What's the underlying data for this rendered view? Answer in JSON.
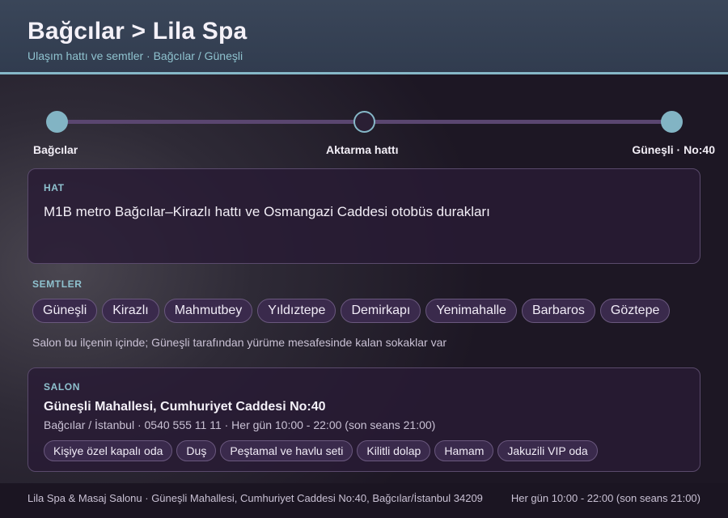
{
  "header": {
    "title": "Bağcılar > Lila Spa",
    "subtitle": "Ulaşım hattı ve semtler · Bağcılar / Güneşli"
  },
  "route": {
    "stops": [
      {
        "label": "Bağcılar",
        "style": "filled"
      },
      {
        "label": "Aktarma hattı",
        "style": "hollow"
      },
      {
        "label": "Güneşli · No:40",
        "style": "filled"
      }
    ]
  },
  "hat": {
    "caption": "HAT",
    "description": "M1B metro Bağcılar–Kirazlı hattı ve Osmangazi Caddesi otobüs durakları"
  },
  "semtler": {
    "caption": "SEMTLER",
    "items": [
      "Güneşli",
      "Kirazlı",
      "Mahmutbey",
      "Yıldıztepe",
      "Demirkapı",
      "Yenimahalle",
      "Barbaros",
      "Göztepe"
    ],
    "note": "Salon bu ilçenin içinde; Güneşli tarafından yürüme mesafesinde kalan sokaklar var"
  },
  "salon": {
    "caption": "SALON",
    "address": "Güneşli Mahallesi, Cumhuriyet Caddesi No:40",
    "meta": "Bağcılar / İstanbul · 0540 555 11 11 · Her gün 10:00 - 22:00 (son seans 21:00)",
    "amenities": [
      "Kişiye özel kapalı oda",
      "Duş",
      "Peştamal ve havlu seti",
      "Kilitli dolap",
      "Hamam",
      "Jakuzili VIP oda"
    ]
  },
  "footer": {
    "left": "Lila Spa & Masaj Salonu · Güneşli Mahallesi, Cumhuriyet Caddesi No:40, Bağcılar/İstanbul 34209",
    "right": "Her gün 10:00 - 22:00 (son seans 21:00)"
  },
  "colors": {
    "accent": "#86b8c8",
    "header_bg": "#343f52",
    "card_bg": "#281b34",
    "route_line": "#5a4670"
  }
}
